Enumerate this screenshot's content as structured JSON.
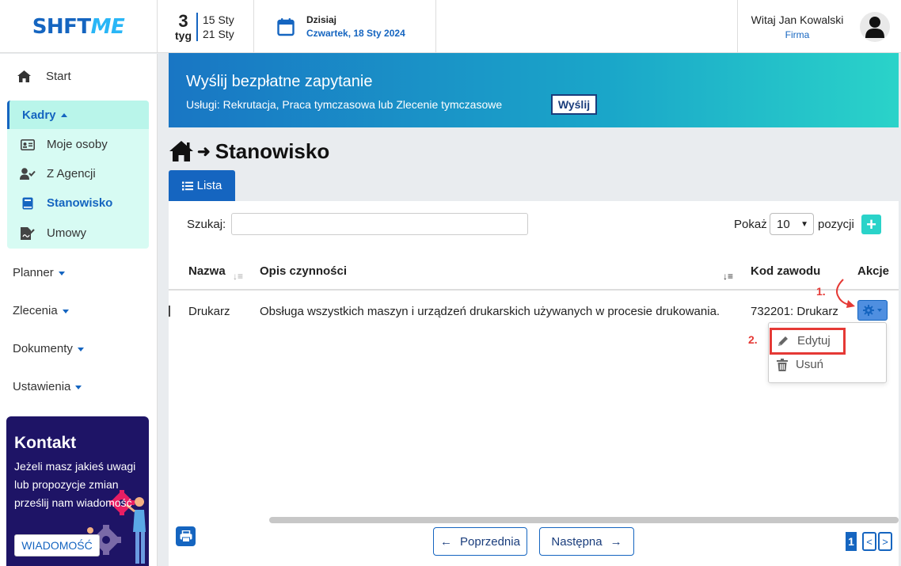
{
  "header": {
    "logo_part1": "SHFT",
    "logo_part2": "ME",
    "week_number": "3",
    "week_label": "tyg",
    "week_start": "15 Sty",
    "week_end": "21 Sty",
    "today_label": "Dzisiaj",
    "today_date": "Czwartek, 18 Sty 2024",
    "greeting": "Witaj Jan Kowalski",
    "company": "Firma"
  },
  "sidebar": {
    "start": "Start",
    "kadry": "Kadry",
    "kadry_items": [
      {
        "label": "Moje osoby",
        "icon": "id-card-icon"
      },
      {
        "label": "Z Agencji",
        "icon": "user-check-icon"
      },
      {
        "label": "Stanowisko",
        "icon": "book-icon",
        "active": true
      },
      {
        "label": "Umowy",
        "icon": "file-signature-icon"
      }
    ],
    "menus": [
      "Planner",
      "Zlecenia",
      "Dokumenty",
      "Ustawienia"
    ],
    "contact": {
      "title": "Kontakt",
      "text": "Jeżeli masz jakieś uwagi lub propozycje zmian prześlij nam wiadomość",
      "button": "WIADOMOŚĆ"
    }
  },
  "banner": {
    "title": "Wyślij bezpłatne zapytanie",
    "subtitle": "Usługi: Rekrutacja, Praca tymczasowa lub Zlecenie tymczasowe",
    "button": "Wyślij"
  },
  "breadcrumb": {
    "page": "Stanowisko"
  },
  "tab": {
    "label": "Lista"
  },
  "table": {
    "search_label": "Szukaj:",
    "search_value": "",
    "show_label": "Pokaż",
    "show_value": "10",
    "positions_label": "pozycji",
    "headers": [
      "Nazwa",
      "Opis czynności",
      "Kod zawodu",
      "Akcje"
    ],
    "rows": [
      {
        "name": "Drukarz",
        "description": "Obsługa wszystkich maszyn i urządzeń drukarskich używanych w procesie drukowania.",
        "code": "732201: Drukarz"
      }
    ],
    "actions": [
      {
        "label": "Edytuj",
        "icon": "pencil-icon"
      },
      {
        "label": "Usuń",
        "icon": "trash-icon"
      }
    ],
    "annotations": [
      "1.",
      "2."
    ]
  },
  "pagination": {
    "prev": "Poprzednia",
    "next": "Następna",
    "current_page": "1"
  },
  "colors": {
    "primary": "#1565c0",
    "accent": "#2ad3c9",
    "highlight": "#e53935"
  }
}
